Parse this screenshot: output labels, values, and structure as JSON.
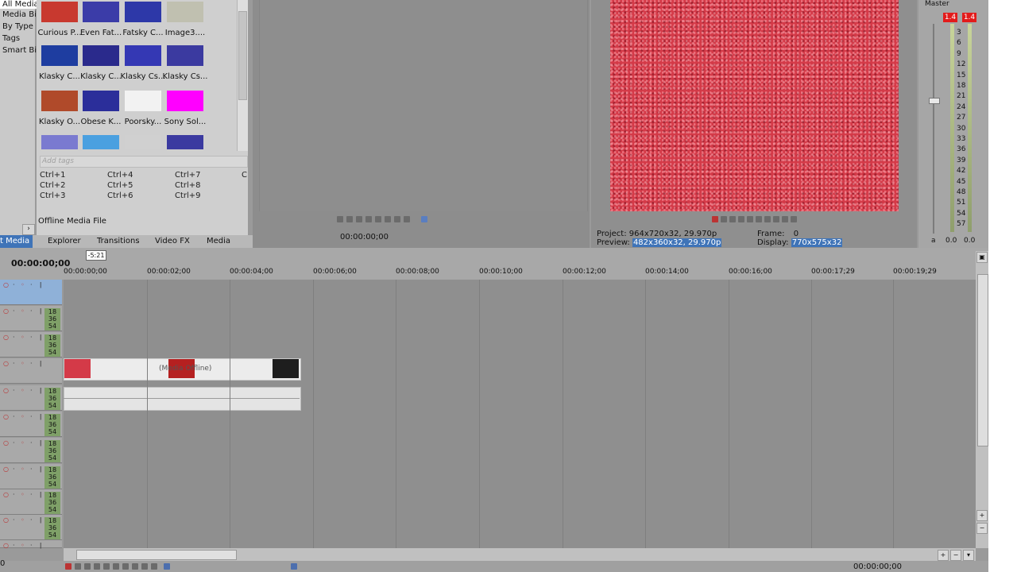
{
  "explorer_tree": {
    "items": [
      "All Media",
      "Media Bir",
      "By Type",
      "Tags",
      "Smart Bir"
    ],
    "expand_glyph": "›"
  },
  "media": {
    "thumbnails": [
      {
        "label": "Curious P...",
        "color": "#c8392f"
      },
      {
        "label": "Even Fat...",
        "color": "#3b3ca8"
      },
      {
        "label": "Fatsky C...",
        "color": "#2d38a8"
      },
      {
        "label": "Image3....",
        "color": "#c0c0b0"
      },
      {
        "label": "Klasky C...",
        "color": "#1e3da0"
      },
      {
        "label": "Klasky C...",
        "color": "#2a2a8c"
      },
      {
        "label": "Klasky Cs...",
        "color": "#3438b4"
      },
      {
        "label": "Klasky Cs...",
        "color": "#3b3aa0"
      },
      {
        "label": "Klasky O...",
        "color": "#b04a2a"
      },
      {
        "label": "Obese K...",
        "color": "#2b2e9a"
      },
      {
        "label": "Poorsky...",
        "color": "#f2f2f2"
      },
      {
        "label": "Sony Sol...",
        "color": "#ff00ff"
      },
      {
        "label": "",
        "color": "#7a7ad0"
      },
      {
        "label": "",
        "color": "#4aa0e0"
      },
      {
        "label": "",
        "color": "#d0d0d0"
      },
      {
        "label": "",
        "color": "#3b3aa0"
      }
    ],
    "tags_placeholder": "Add tags",
    "shortcuts": [
      "Ctrl+1",
      "Ctrl+4",
      "Ctrl+7",
      "C",
      "Ctrl+2",
      "Ctrl+5",
      "Ctrl+8",
      "Ctrl+3",
      "Ctrl+6",
      "Ctrl+9"
    ],
    "offline_label": "Offline Media File"
  },
  "tabs": [
    "t Media",
    "Explorer",
    "Transitions",
    "Video FX",
    "Media"
  ],
  "trimmer": {
    "time": "00:00:00;00"
  },
  "preview": {
    "project_label": "Project:",
    "project_value": "964x720x32, 29.970p",
    "preview_label": "Preview:",
    "preview_value": "482x360x32, 29.970p",
    "frame_label": "Frame:",
    "frame_value": "0",
    "display_label": "Display:",
    "display_value": "770x575x32",
    "frame_color": "#d43a48"
  },
  "master": {
    "title": "Master",
    "peak_left": "1.4",
    "peak_right": "1.4",
    "scale": [
      "3",
      "6",
      "9",
      "12",
      "15",
      "18",
      "21",
      "24",
      "27",
      "30",
      "33",
      "36",
      "39",
      "42",
      "45",
      "48",
      "51",
      "54",
      "57"
    ],
    "bottom_left": "a",
    "level_left": "0.0",
    "level_right": "0.0"
  },
  "timeline": {
    "timecode": "00:00:00;00",
    "marker_label": "-5:21",
    "ruler": [
      "00:00:00;00",
      "00:00:02;00",
      "00:00:04;00",
      "00:00:06;00",
      "00:00:08;00",
      "00:00:10;00",
      "00:00:12;00",
      "00:00:14;00",
      "00:00:16;00",
      "00:00:17;29",
      "00:00:19;29"
    ],
    "level_labels": [
      "18",
      "36",
      "54"
    ],
    "video_clip_label": "(Media Offline)",
    "bottom_time": "00:00:00;00",
    "bottom_left_label": "0"
  }
}
